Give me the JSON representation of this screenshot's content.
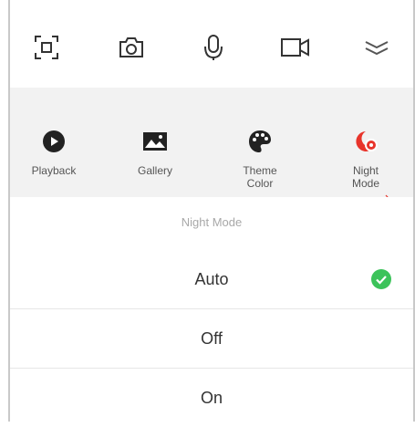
{
  "toolbar": {
    "buttons": [
      {
        "icon": "scan-icon"
      },
      {
        "icon": "camera-icon"
      },
      {
        "icon": "microphone-icon"
      },
      {
        "icon": "video-camera-icon"
      },
      {
        "icon": "collapse-icon"
      }
    ]
  },
  "shortcuts": {
    "items": [
      {
        "label": "Playback",
        "icon": "playback-icon"
      },
      {
        "label": "Gallery",
        "icon": "gallery-icon"
      },
      {
        "label": "Theme\nColor",
        "icon": "palette-icon"
      },
      {
        "label": "Night\nMode",
        "icon": "night-mode-icon",
        "accent": "#e8342b"
      }
    ]
  },
  "night_mode": {
    "title": "Night Mode",
    "options": [
      {
        "label": "Auto",
        "selected": true
      },
      {
        "label": "Off",
        "selected": false
      },
      {
        "label": "On",
        "selected": false
      }
    ],
    "check_color": "#3cc35a"
  },
  "colors": {
    "icon_stroke": "#333333",
    "strip_bg": "#f2f2f2",
    "accent": "#e8342b"
  }
}
